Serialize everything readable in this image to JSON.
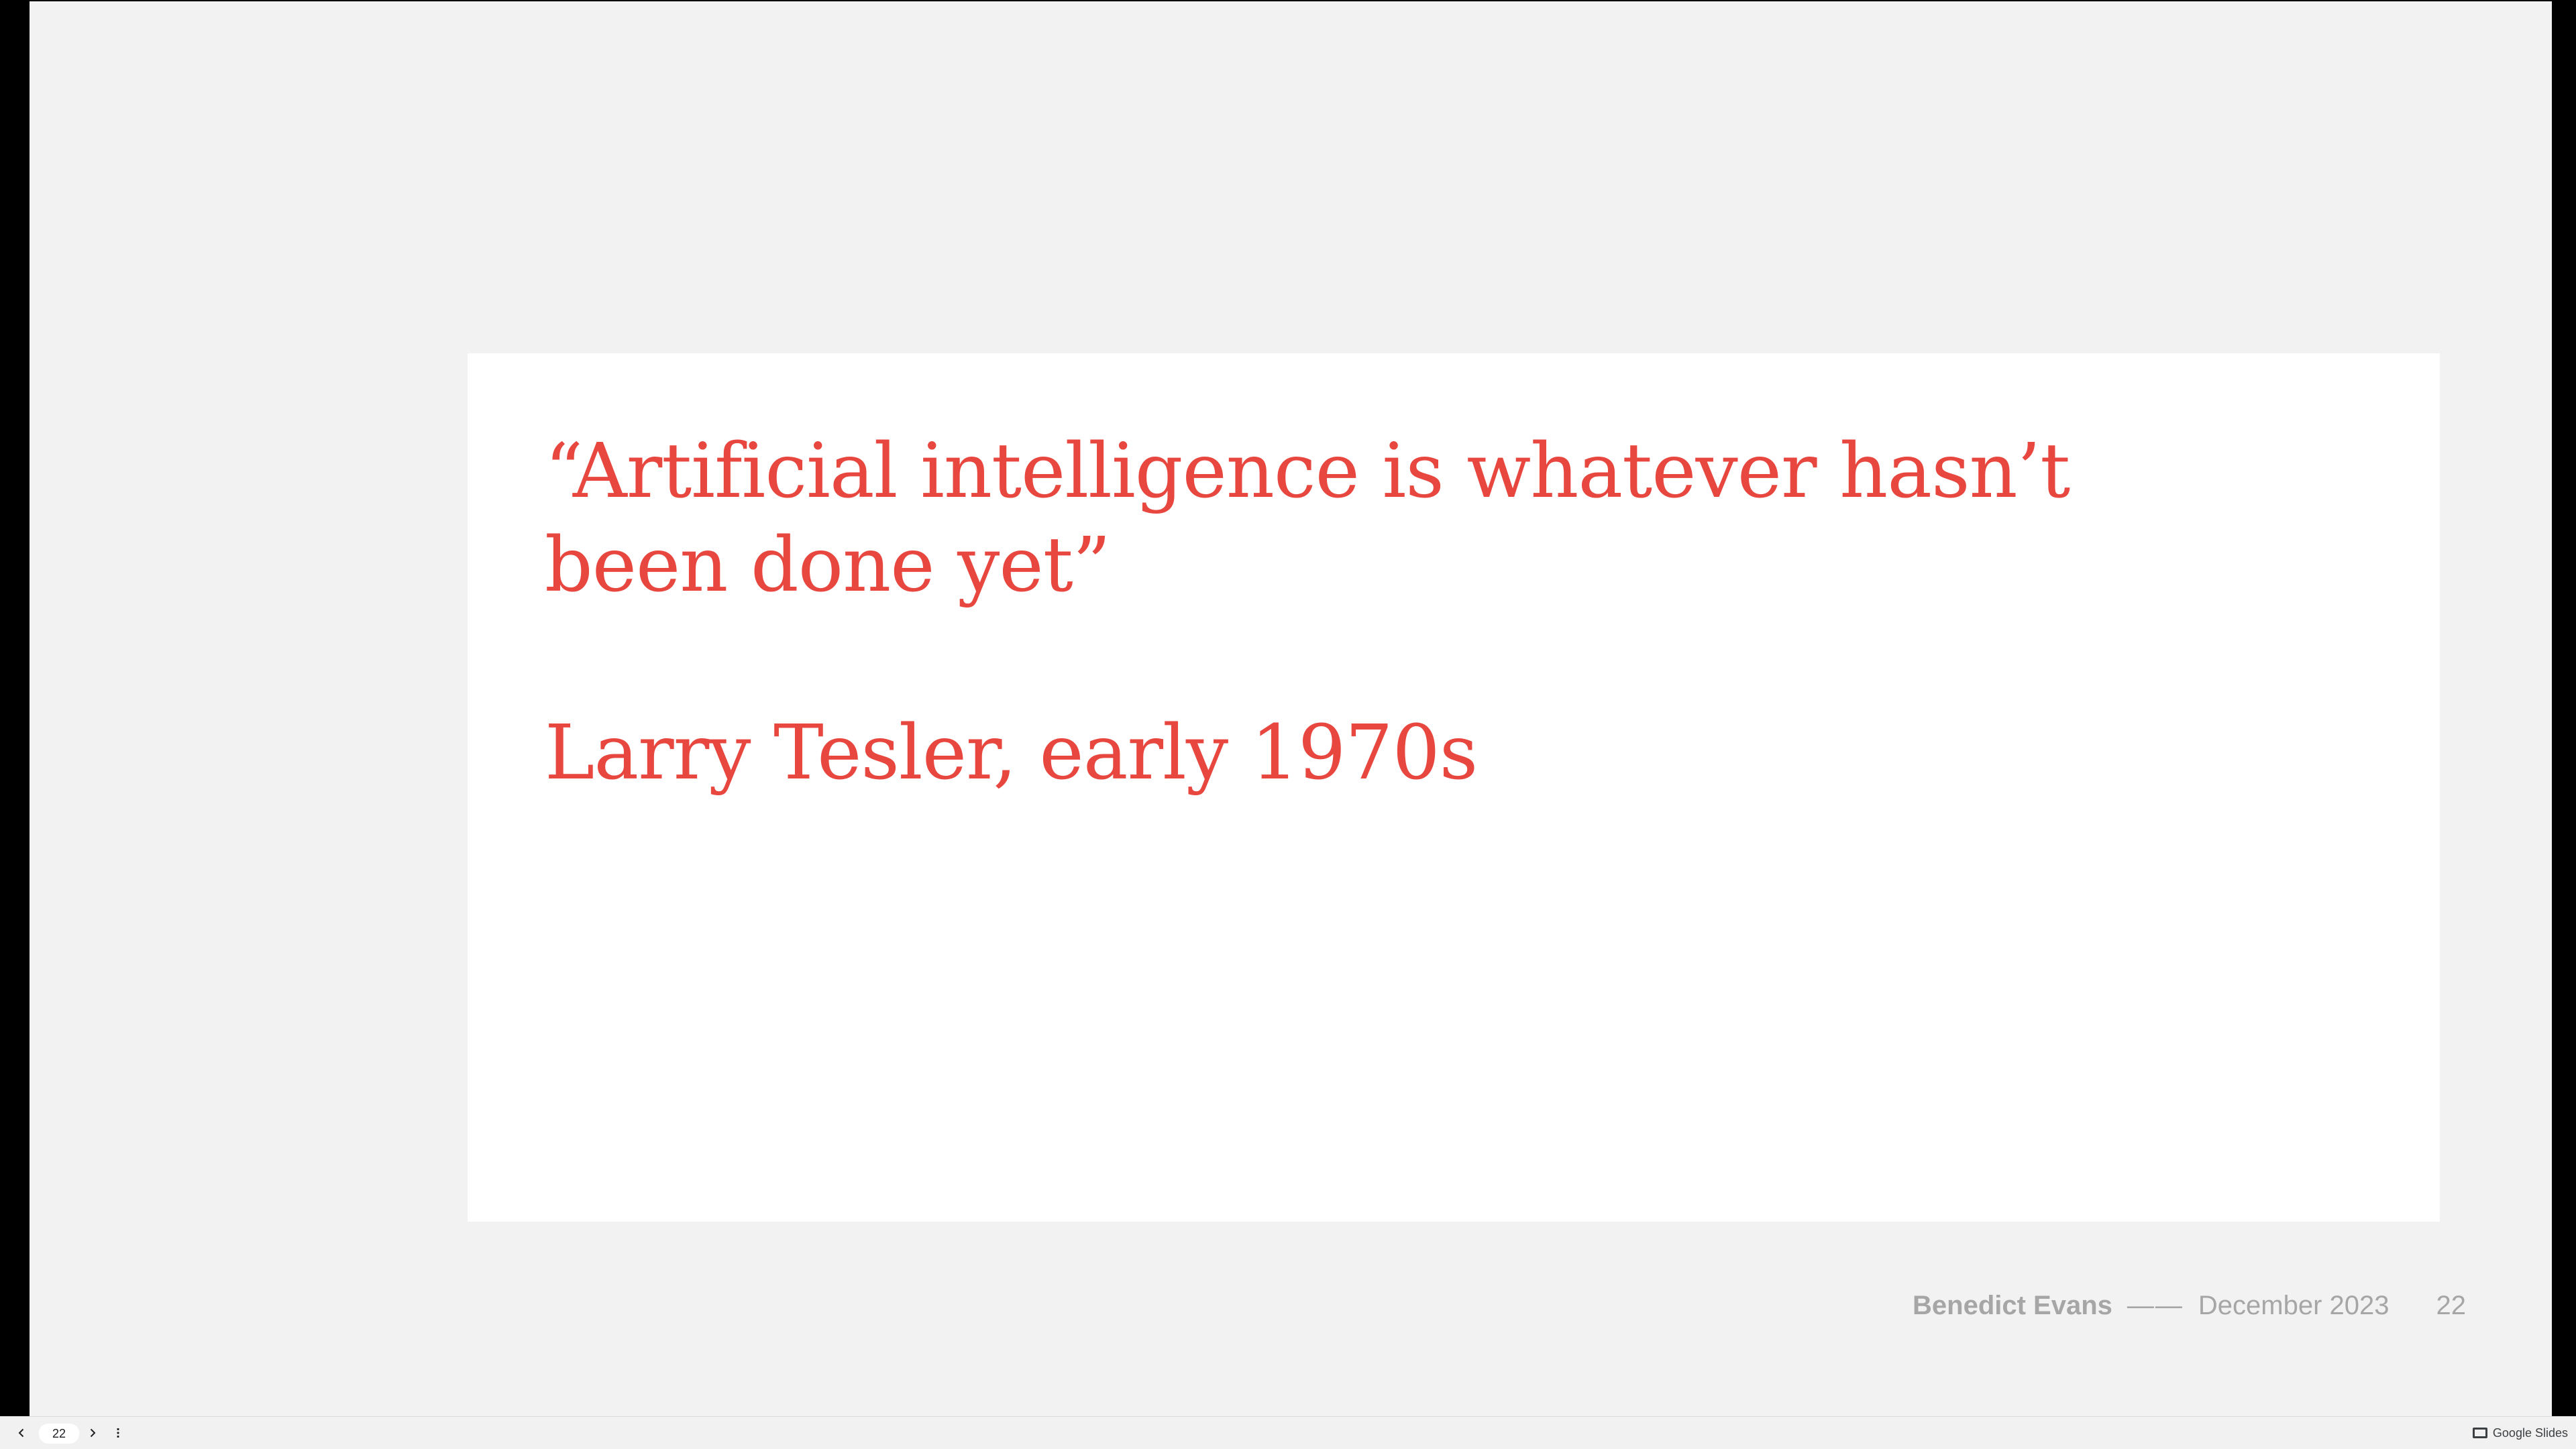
{
  "slide": {
    "quote_line_1": "“Artificial intelligence is whatever hasn’t",
    "quote_line_2": "been done yet”",
    "attribution": "Larry Tesler, early 1970s",
    "accent_color": "#e8473f"
  },
  "footer": {
    "author": "Benedict Evans",
    "separator": "——",
    "date": "December 2023",
    "page": "22"
  },
  "controls": {
    "prev_icon": "chevron-left-icon",
    "next_icon": "chevron-right-icon",
    "more_icon": "more-vert-icon",
    "page_value": "22",
    "brand_label": "Google Slides",
    "brand_icon": "slides-icon"
  }
}
